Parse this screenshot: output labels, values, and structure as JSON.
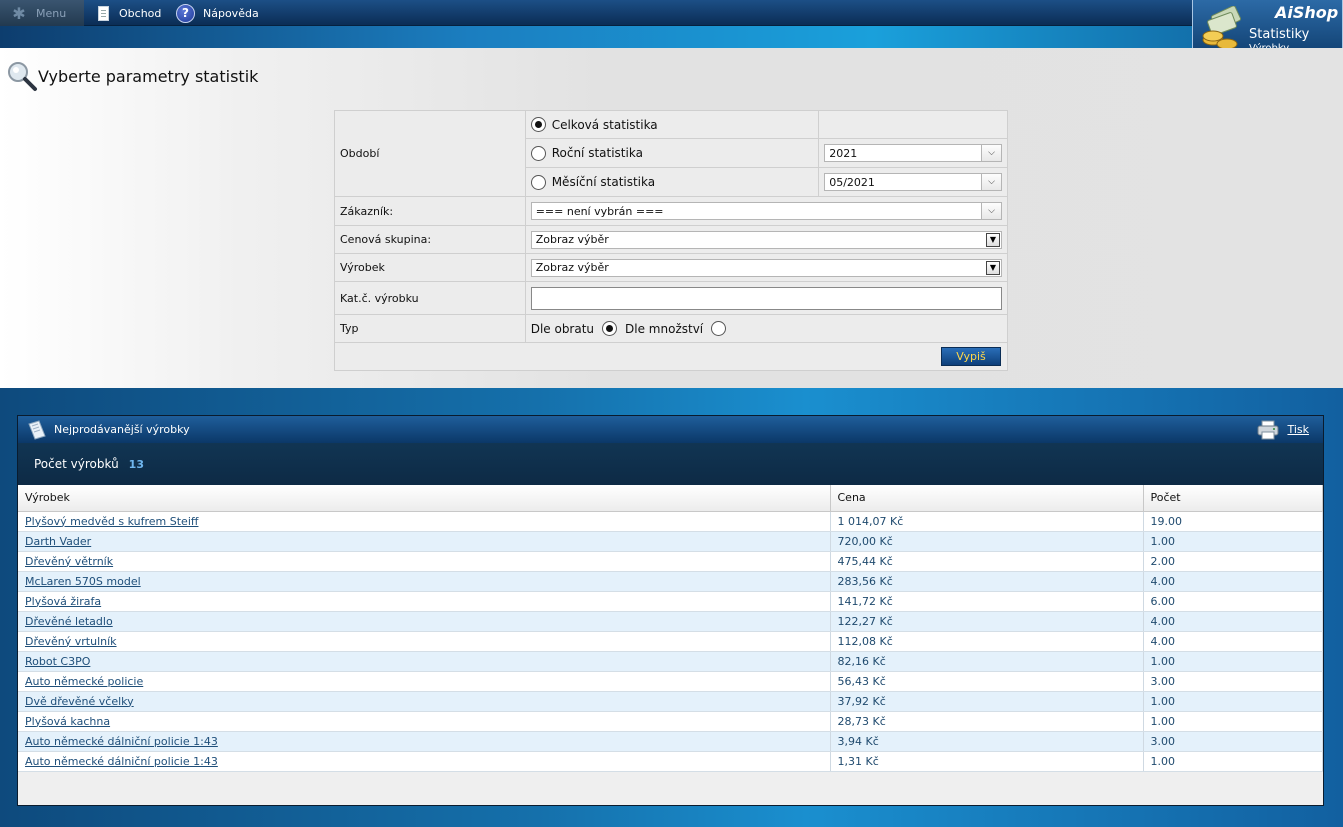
{
  "menu": {
    "menu_label": "Menu",
    "shop_label": "Obchod",
    "help_label": "Nápověda"
  },
  "logo": {
    "brand_a": "Ai",
    "brand_b": "Shop",
    "title": "Statistiky",
    "subtitle": "Výrobky"
  },
  "page": {
    "title": "Vyberte parametry statistik"
  },
  "form": {
    "period_label": "Období",
    "radio_total": "Celková statistika",
    "radio_year": "Roční statistika",
    "radio_month": "Měsíční statistika",
    "year_value": "2021",
    "month_value": "05/2021",
    "customer_label": "Zákazník:",
    "customer_value": "=== není vybrán ===",
    "price_group_label": "Cenová skupina:",
    "price_group_value": "Zobraz výběr",
    "product_label": "Výrobek",
    "product_value": "Zobraz výběr",
    "catno_label": "Kat.č. výrobku",
    "catno_value": "",
    "type_label": "Typ",
    "type_turnover": "Dle obratu",
    "type_quantity": "Dle množství",
    "submit_label": "Vypiš"
  },
  "panel": {
    "title": "Nejprodávanější výrobky",
    "print_label": "Tisk",
    "count_label": "Počet výrobků",
    "count_value": "13",
    "columns": [
      "Výrobek",
      "Cena",
      "Počet"
    ],
    "rows": [
      [
        "Plyšový medvěd s kufrem Steiff",
        "1 014,07 Kč",
        "19.00"
      ],
      [
        "Darth Vader",
        "720,00 Kč",
        "1.00"
      ],
      [
        "Dřevěný větrník",
        "475,44 Kč",
        "2.00"
      ],
      [
        "McLaren 570S model",
        "283,56 Kč",
        "4.00"
      ],
      [
        "Plyšová žirafa",
        "141,72 Kč",
        "6.00"
      ],
      [
        "Dřevěné letadlo",
        "122,27 Kč",
        "4.00"
      ],
      [
        "Dřevěný vrtulník",
        "112,08 Kč",
        "4.00"
      ],
      [
        "Robot C3PO",
        "82,16 Kč",
        "1.00"
      ],
      [
        "Auto německé policie",
        "56,43 Kč",
        "3.00"
      ],
      [
        "Dvě dřevěné včelky",
        "37,92 Kč",
        "1.00"
      ],
      [
        "Plyšová kachna",
        "28,73 Kč",
        "1.00"
      ],
      [
        "Auto německé dálniční policie 1:43",
        "3,94 Kč",
        "3.00"
      ],
      [
        "Auto německé dálniční policie 1:43",
        "1,31 Kč",
        "1.00"
      ]
    ]
  }
}
